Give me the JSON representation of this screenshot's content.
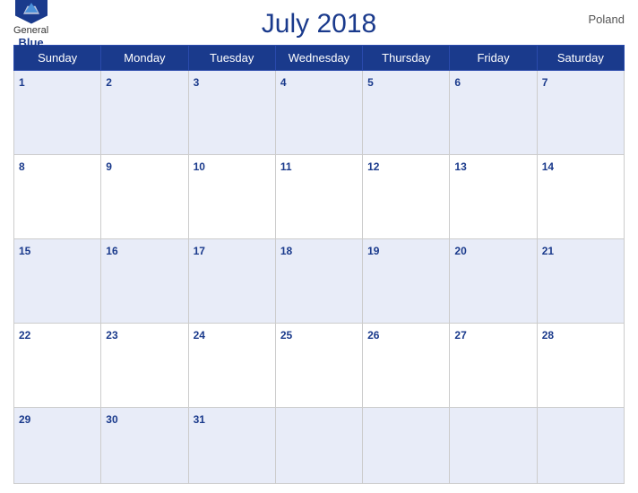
{
  "header": {
    "logo": {
      "general": "General",
      "blue": "Blue"
    },
    "title": "July 2018",
    "country": "Poland"
  },
  "weekdays": [
    "Sunday",
    "Monday",
    "Tuesday",
    "Wednesday",
    "Thursday",
    "Friday",
    "Saturday"
  ],
  "weeks": [
    [
      1,
      2,
      3,
      4,
      5,
      6,
      7
    ],
    [
      8,
      9,
      10,
      11,
      12,
      13,
      14
    ],
    [
      15,
      16,
      17,
      18,
      19,
      20,
      21
    ],
    [
      22,
      23,
      24,
      25,
      26,
      27,
      28
    ],
    [
      29,
      30,
      31,
      null,
      null,
      null,
      null
    ]
  ]
}
